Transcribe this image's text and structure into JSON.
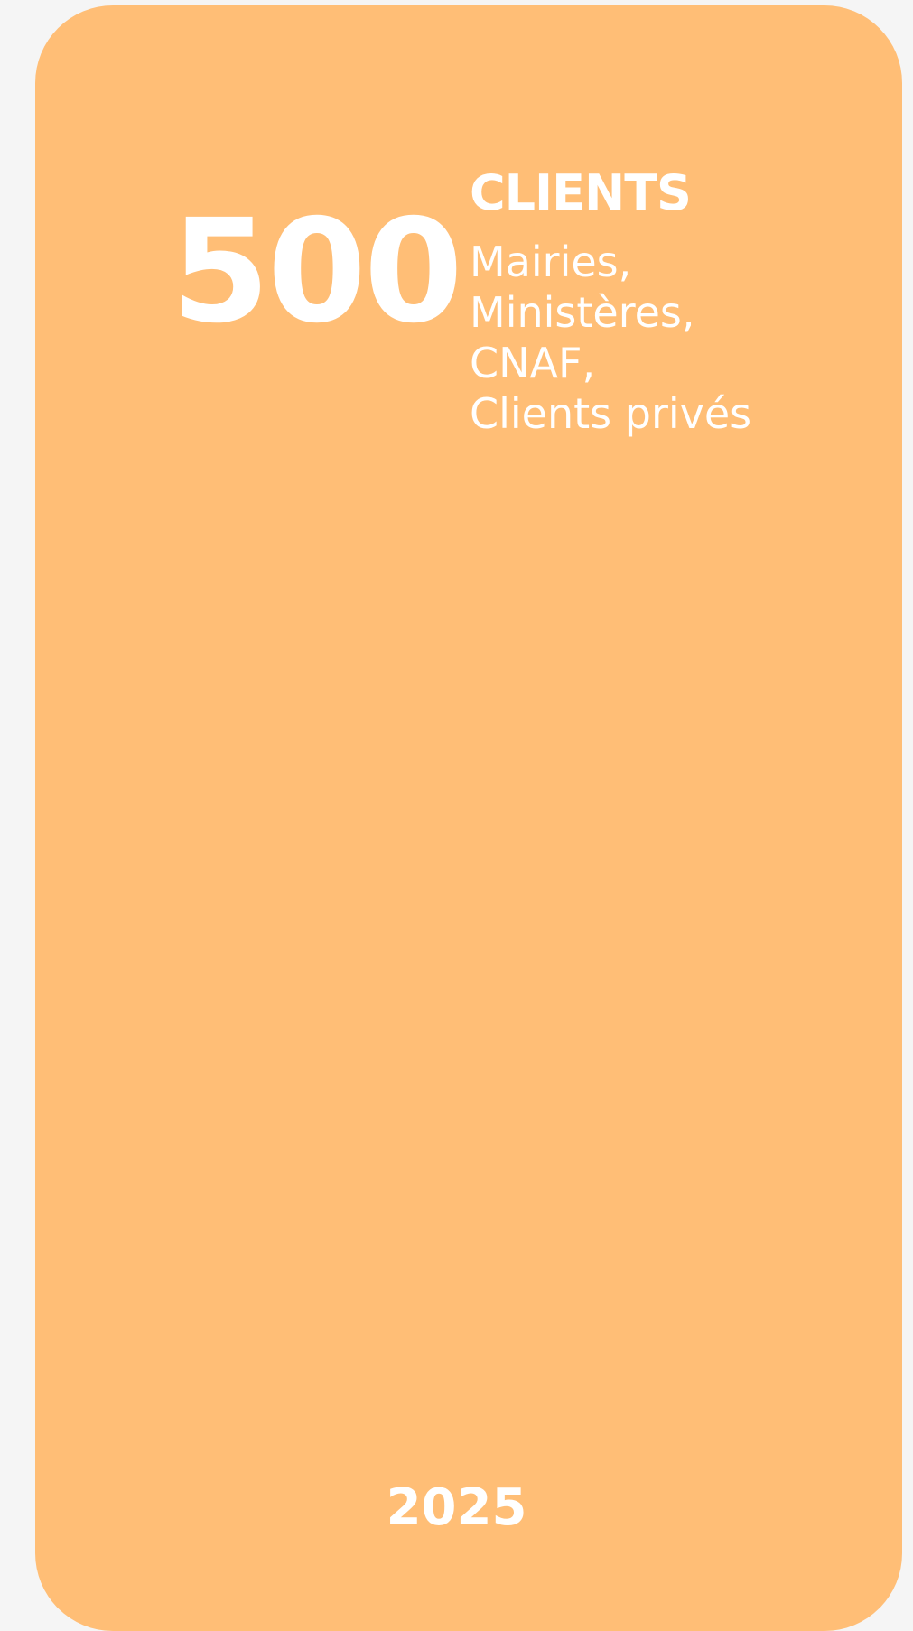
{
  "stat": {
    "number": "500",
    "heading": "CLIENTS",
    "items": [
      "Mairies,",
      "Ministères,",
      "CNAF,",
      "Clients privés"
    ]
  },
  "footer": {
    "year": "2025"
  },
  "colors": {
    "page_background": "#f5f5f5",
    "card_background": "#ffbe76",
    "text": "#ffffff"
  }
}
